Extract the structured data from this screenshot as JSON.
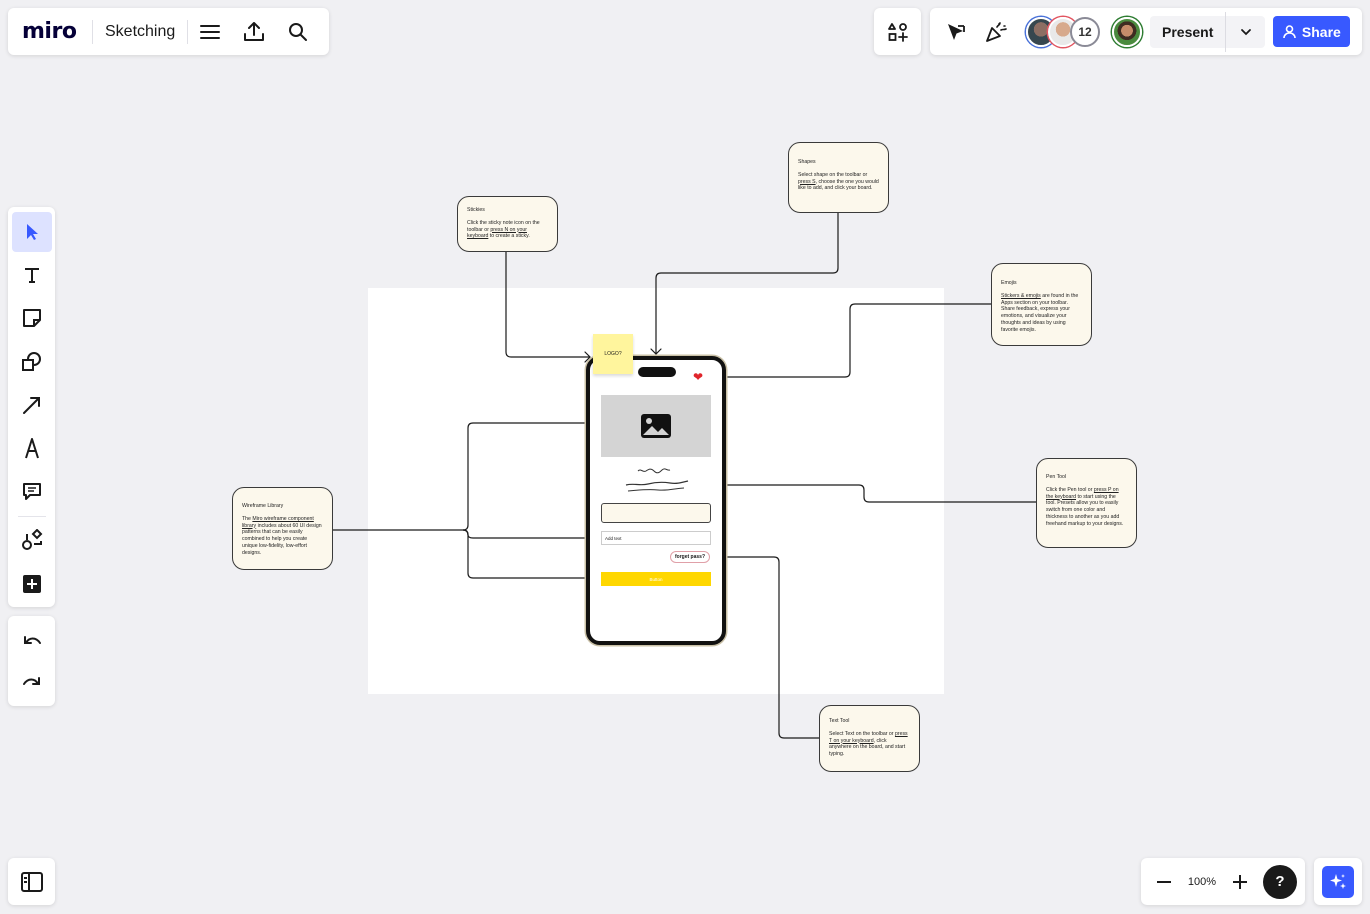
{
  "app": {
    "logo": "miro",
    "board_title": "Sketching"
  },
  "header": {
    "avatar_extra_count": "12",
    "present_label": "Present",
    "share_label": "Share"
  },
  "zoom": {
    "value": "100%"
  },
  "help": {
    "label": "?"
  },
  "canvas": {
    "notes": {
      "stickies": {
        "title": "Stickies",
        "body_pre": "Click the sticky note icon on the toolbar or ",
        "body_link": "press N on your keyboard",
        "body_post": " to create a sticky."
      },
      "shapes": {
        "title": "Shapes",
        "body_pre": "Select shape on the toolbar or ",
        "body_link": "press S",
        "body_post": ", choose the one you would like to add, and click your board."
      },
      "emojis": {
        "title": "Emojis",
        "body_link": "Stickers & emojis",
        "body_post": " are found in the Apps section on your toolbar. Share feedback, express your emotions, and visualize your thoughts and ideas by using favorite emojis."
      },
      "pen": {
        "title": "Pen Tool",
        "body_pre": "Click the Pen tool or ",
        "body_link": "press P on the keyboard",
        "body_post": " to start using the tool. Presets allow you to easily switch from one color and thickness to another as you add freehand markup to your designs."
      },
      "text": {
        "title": "Text Tool",
        "body_pre": "Select Text on the toolbar or ",
        "body_link": "press T on your keyboard",
        "body_post": ", click anywhere on the board, and start typing."
      },
      "wireframe": {
        "title": "Wireframe Library",
        "body_pre": "The ",
        "body_link": "Miro wireframe component library",
        "body_post": " includes about 60 UI design patterns that can be easily combined to help you create unique low-fidelity, low-effort designs."
      }
    },
    "sticky_label": "LOGO?",
    "phone": {
      "add_text": "Add text",
      "forgot": "forget pass?",
      "button": "Button"
    }
  },
  "colors": {
    "accent": "#3859ff",
    "note_bg": "#fcf8ec",
    "sticky": "#fff59d",
    "button_yellow": "#ffd700"
  }
}
